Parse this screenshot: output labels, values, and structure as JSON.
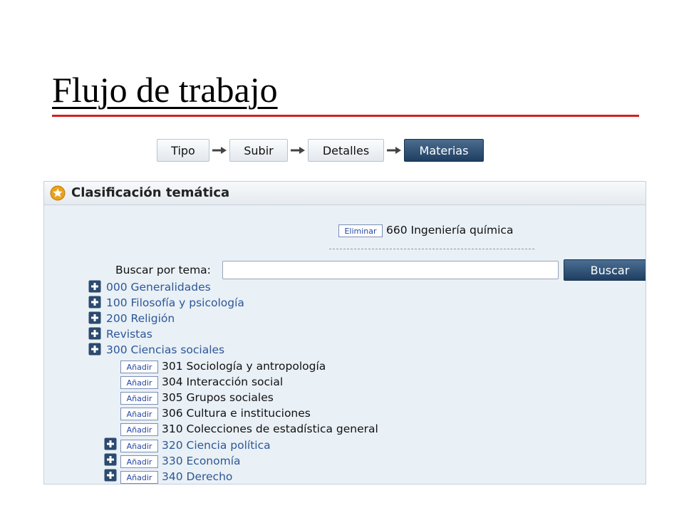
{
  "slide": {
    "title": "Flujo de trabajo"
  },
  "colors": {
    "title_rule": "#d42020",
    "active_step": "#2b4c70",
    "link": "#2d5797"
  },
  "workflow": {
    "steps": [
      {
        "label": "Tipo",
        "active": false
      },
      {
        "label": "Subir",
        "active": false
      },
      {
        "label": "Detalles",
        "active": false
      },
      {
        "label": "Materias",
        "active": true
      }
    ]
  },
  "panel": {
    "icon": "star-icon",
    "title": "Clasificación temática",
    "selected": {
      "button": "Eliminar",
      "label": "660 Ingeniería química"
    },
    "search": {
      "label": "Buscar por tema:",
      "value": "",
      "button": "Buscar"
    },
    "tree": {
      "top": [
        "000 Generalidades",
        "100 Filosofía y psicología",
        "200 Religión",
        "Revistas",
        "300 Ciencias sociales"
      ],
      "add_button": "Añadir",
      "leaves": [
        "301 Sociología y antropología",
        "304 Interacción social",
        "305 Grupos sociales",
        "306 Cultura e instituciones",
        "310 Colecciones de estadística general"
      ],
      "branches": [
        "320 Ciencia política",
        "330 Economía",
        "340 Derecho"
      ]
    }
  }
}
